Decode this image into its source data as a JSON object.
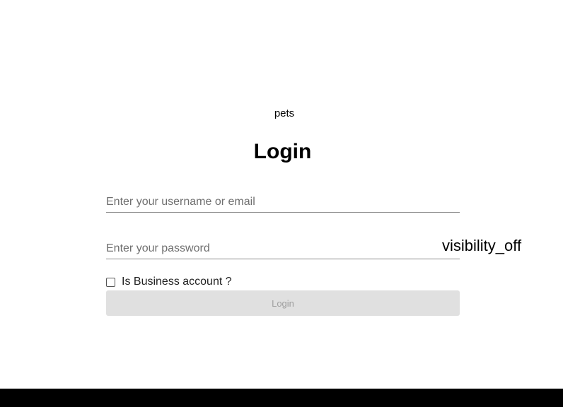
{
  "header": {
    "logo_text": "pets",
    "title": "Login"
  },
  "form": {
    "username_placeholder": "Enter your username or email",
    "password_placeholder": "Enter your password",
    "visibility_toggle_label": "visibility_off",
    "business_checkbox_label": "Is Business account ?",
    "business_checked": false,
    "submit_label": "Login"
  },
  "colors": {
    "button_bg": "#e0e0e0",
    "button_text": "#9e9e9e",
    "bottom_bar": "#000000"
  }
}
